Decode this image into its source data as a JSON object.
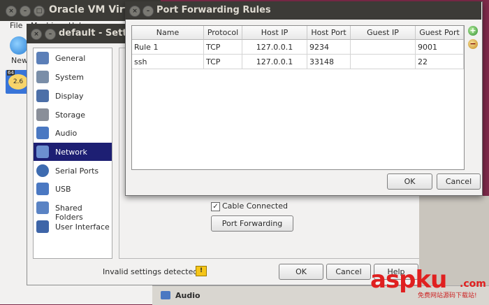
{
  "main_window": {
    "title": "Oracle VM Virtual",
    "menu": [
      "File",
      "Machine",
      "Help"
    ],
    "new_label": "New",
    "vm_badge": "64",
    "vm_version": "2.6"
  },
  "settings_window": {
    "title": "default - Setting",
    "categories": [
      {
        "label": "General",
        "icon": "general-icon",
        "selected": false
      },
      {
        "label": "System",
        "icon": "system-icon",
        "selected": false
      },
      {
        "label": "Display",
        "icon": "display-icon",
        "selected": false
      },
      {
        "label": "Storage",
        "icon": "storage-icon",
        "selected": false
      },
      {
        "label": "Audio",
        "icon": "audio-icon",
        "selected": false
      },
      {
        "label": "Network",
        "icon": "network-icon",
        "selected": true
      },
      {
        "label": "Serial Ports",
        "icon": "serial-ports-icon",
        "selected": false
      },
      {
        "label": "USB",
        "icon": "usb-icon",
        "selected": false
      },
      {
        "label": "Shared Folders",
        "icon": "shared-folders-icon",
        "selected": false
      },
      {
        "label": "User Interface",
        "icon": "user-interface-icon",
        "selected": false
      }
    ],
    "cable_connected_label": "Cable Connected",
    "cable_connected_checked": true,
    "port_forwarding_button": "Port Forwarding",
    "invalid_settings": "Invalid settings detected",
    "ok_label": "OK",
    "cancel_label": "Cancel",
    "help_label": "Help",
    "audio_section_label": "Audio"
  },
  "port_forwarding": {
    "title": "Port Forwarding Rules",
    "columns": [
      "Name",
      "Protocol",
      "Host IP",
      "Host Port",
      "Guest IP",
      "Guest Port"
    ],
    "rows": [
      [
        "Rule 1",
        "TCP",
        "127.0.0.1",
        "9234",
        "",
        "9001"
      ],
      [
        "ssh",
        "TCP",
        "127.0.0.1",
        "33148",
        "",
        "22"
      ]
    ],
    "ok_label": "OK",
    "cancel_label": "Cancel"
  },
  "watermark": {
    "brand": "aspku",
    "domain": ".com",
    "subtitle": "免费网站源码下载站!"
  },
  "colors": {
    "titlebar": "#3c3b37",
    "selection": "#1d1f73",
    "desktop": "#7d2a4a"
  }
}
